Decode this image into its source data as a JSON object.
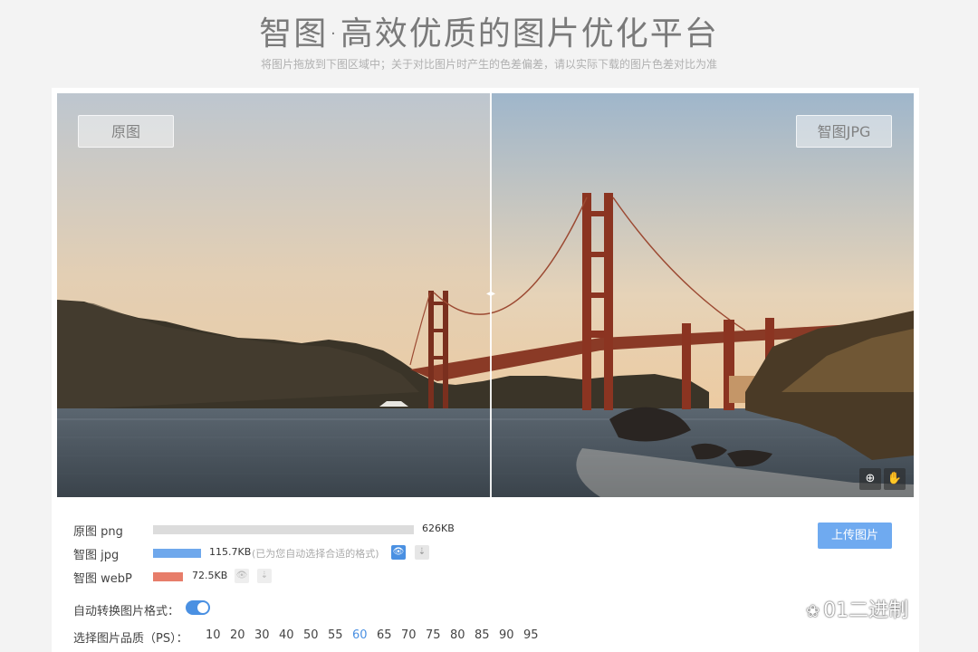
{
  "header": {
    "title": "智图·高效优质的图片优化平台",
    "subtitle": "将图片拖放到下图区域中；关于对比图片时产生的色差偏差，请以实际下载的图片色差对比为准"
  },
  "compare": {
    "left_label": "原图",
    "right_label": "智图JPG",
    "divider_handle": "◂▸",
    "zoom_glyph": "⊕",
    "hand_glyph": "✋"
  },
  "formats": [
    {
      "name": "原图 png",
      "size": "626KB",
      "bar_color": "#dcdcdc",
      "relative_size": 1.0
    },
    {
      "name": "智图 jpg",
      "size": "115.7KB",
      "hint": "(已为您自动选择合适的格式)",
      "bar_color": "#6fa8ec",
      "relative_size": 0.185
    },
    {
      "name": "智图 webP",
      "size": "72.5KB",
      "bar_color": "#e77d6a",
      "relative_size": 0.116
    }
  ],
  "upload_label": "上传图片",
  "auto_convert_label": "自动转换图片格式：",
  "auto_convert_on": true,
  "quality_label": "选择图片品质（PS）：",
  "quality_options": [
    "10",
    "20",
    "30",
    "40",
    "50",
    "55",
    "60",
    "65",
    "70",
    "75",
    "80",
    "85",
    "90",
    "95"
  ],
  "quality_selected": "60",
  "icons": {
    "eye": "👁",
    "download": "⇣"
  },
  "watermark": {
    "icon": "❀",
    "text": "01二进制"
  },
  "colors": {
    "accent": "#4a90e2",
    "upload": "#6faaf0"
  }
}
